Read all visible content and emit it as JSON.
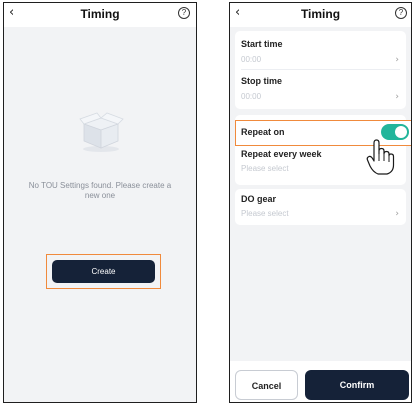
{
  "left_screen": {
    "title": "Timing",
    "back_icon": "chevron-left-icon",
    "help_icon": "question-circle-icon",
    "help_glyph": "?",
    "empty_message": "No TOU Settings found. Please create a new one",
    "create_label": "Create"
  },
  "right_screen": {
    "title": "Timing",
    "help_glyph": "?",
    "start_time": {
      "label": "Start time",
      "value": "00:00"
    },
    "stop_time": {
      "label": "Stop time",
      "value": "00:00"
    },
    "repeat_on": {
      "label": "Repeat on",
      "enabled": true
    },
    "repeat_every_week": {
      "label": "Repeat every week",
      "placeholder": "Please select"
    },
    "do_gear": {
      "label": "DO gear",
      "placeholder": "Please select"
    },
    "cancel_label": "Cancel",
    "confirm_label": "Confirm"
  },
  "colors": {
    "primary_dark": "#152238",
    "highlight": "#f08a3c",
    "toggle_on": "#22b59b",
    "screen_bg": "#f2f3f5"
  }
}
